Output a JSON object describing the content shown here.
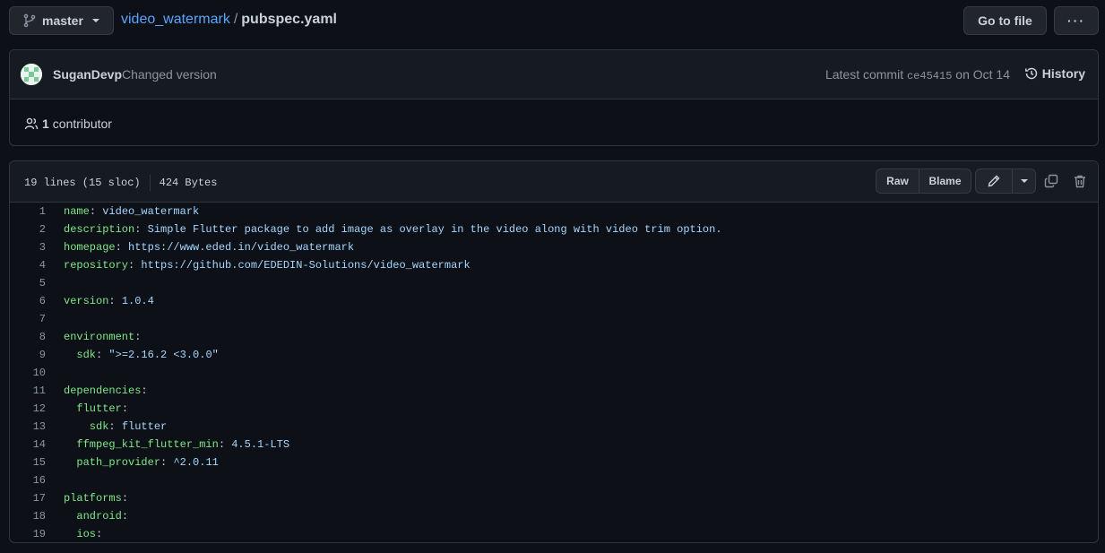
{
  "branch": {
    "name": "master"
  },
  "breadcrumb": {
    "repo": "video_watermark",
    "separator": "/",
    "file": "pubspec.yaml"
  },
  "header": {
    "go_to_file": "Go to file",
    "more": "···"
  },
  "commit": {
    "author": "SuganDevp",
    "message": "Changed version",
    "latest_label": "Latest commit",
    "sha": "ce45415",
    "date_text": "on Oct 14",
    "history_label": "History"
  },
  "contributors": {
    "count": "1",
    "label": "contributor"
  },
  "file": {
    "lines_info": "19 lines (15 sloc)",
    "size": "424 Bytes",
    "raw_label": "Raw",
    "blame_label": "Blame"
  },
  "code_lines": [
    {
      "n": "1",
      "key": "name",
      "colon": ": ",
      "val": "video_watermark"
    },
    {
      "n": "2",
      "key": "description",
      "colon": ": ",
      "val": "Simple Flutter package to add image as overlay in the video along with video trim option."
    },
    {
      "n": "3",
      "key": "homepage",
      "colon": ": ",
      "val": "https://www.eded.in/video_watermark"
    },
    {
      "n": "4",
      "key": "repository",
      "colon": ": ",
      "val": "https://github.com/EDEDIN-Solutions/video_watermark"
    },
    {
      "n": "5",
      "key": "",
      "colon": "",
      "val": ""
    },
    {
      "n": "6",
      "key": "version",
      "colon": ": ",
      "val": "1.0.4"
    },
    {
      "n": "7",
      "key": "",
      "colon": "",
      "val": ""
    },
    {
      "n": "8",
      "key": "environment",
      "colon": ":",
      "val": ""
    },
    {
      "n": "9",
      "key": "  sdk",
      "colon": ": ",
      "val": "\">=2.16.2 <3.0.0\""
    },
    {
      "n": "10",
      "key": "",
      "colon": "",
      "val": ""
    },
    {
      "n": "11",
      "key": "dependencies",
      "colon": ":",
      "val": ""
    },
    {
      "n": "12",
      "key": "  flutter",
      "colon": ":",
      "val": ""
    },
    {
      "n": "13",
      "key": "    sdk",
      "colon": ": ",
      "val": "flutter"
    },
    {
      "n": "14",
      "key": "  ffmpeg_kit_flutter_min",
      "colon": ": ",
      "val": "4.5.1-LTS"
    },
    {
      "n": "15",
      "key": "  path_provider",
      "colon": ": ",
      "val": "^2.0.11"
    },
    {
      "n": "16",
      "key": "",
      "colon": "",
      "val": ""
    },
    {
      "n": "17",
      "key": "platforms",
      "colon": ":",
      "val": ""
    },
    {
      "n": "18",
      "key": "  android",
      "colon": ":",
      "val": ""
    },
    {
      "n": "19",
      "key": "  ios",
      "colon": ":",
      "val": ""
    }
  ]
}
